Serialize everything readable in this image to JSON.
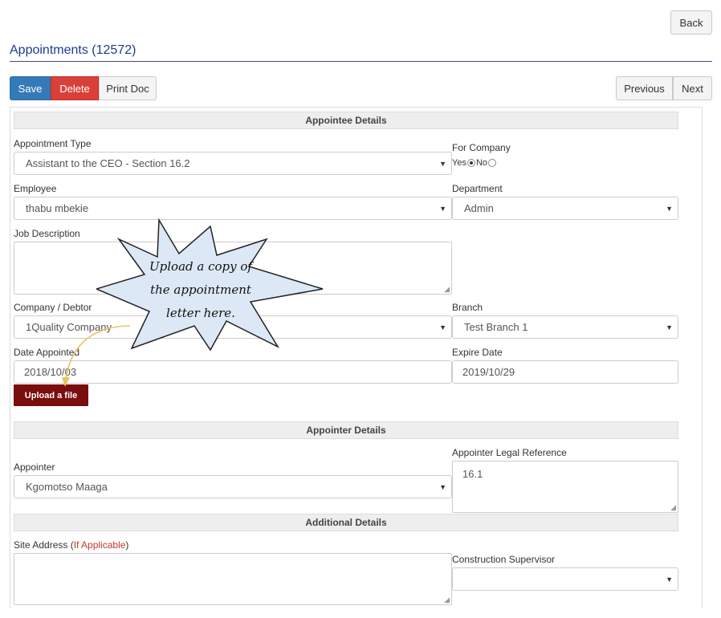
{
  "header": {
    "back_label": "Back",
    "page_title": "Appointments (12572)"
  },
  "toolbar": {
    "save_label": "Save",
    "delete_label": "Delete",
    "print_label": "Print Doc",
    "previous_label": "Previous",
    "next_label": "Next"
  },
  "sections": {
    "appointee": "Appointee Details",
    "appointer": "Appointer Details",
    "additional": "Additional Details"
  },
  "fields": {
    "appointment_type": {
      "label": "Appointment Type",
      "value": "Assistant to the CEO - Section 16.2"
    },
    "for_company": {
      "label": "For Company",
      "yes": "Yes",
      "no": "No",
      "selected": "Yes"
    },
    "employee": {
      "label": "Employee",
      "value": "thabu mbekie"
    },
    "department": {
      "label": "Department",
      "value": "Admin"
    },
    "job_description": {
      "label": "Job Description",
      "value": ""
    },
    "company_debtor": {
      "label": "Company / Debtor",
      "value": "1Quality Company"
    },
    "branch": {
      "label": "Branch",
      "value": "Test Branch 1"
    },
    "date_appointed": {
      "label": "Date Appointed",
      "value": "2018/10/03"
    },
    "expire_date": {
      "label": "Expire Date",
      "value": "2019/10/29"
    },
    "upload_label": "Upload a file",
    "appointer": {
      "label": "Appointer",
      "value": "Kgomotso Maaga"
    },
    "appointer_legal_reference": {
      "label": "Appointer Legal Reference",
      "value": "16.1"
    },
    "site_address": {
      "label": "Site Address (",
      "hint": "If Applicable",
      "label_end": ")",
      "value": ""
    },
    "construction_supervisor": {
      "label": "Construction Supervisor",
      "value": ""
    }
  },
  "callout": {
    "lines": [
      "Upload a copy of",
      "the appointment",
      "letter here."
    ]
  },
  "colors": {
    "primary": "#337ab7",
    "danger": "#d9403a",
    "upload": "#7a0d0d",
    "callout_fill": "#dce8f5",
    "title": "#1f3a93"
  }
}
